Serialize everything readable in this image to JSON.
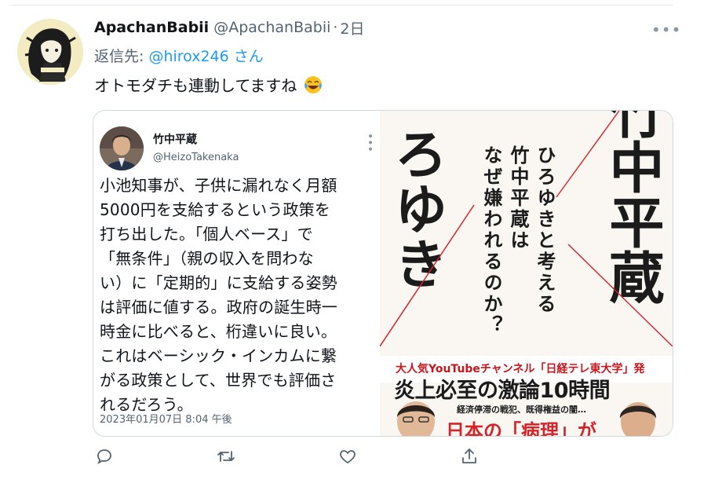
{
  "tweet": {
    "display_name": "ApachanBabii",
    "handle": "@ApachanBabii",
    "separator": "·",
    "time": "2日",
    "reply_prefix": "返信先: ",
    "reply_to": "@hirox246",
    "reply_suffix": " さん",
    "text": "オトモダチも連動してますね",
    "emoji": "laughing-tears-emoji"
  },
  "quoted": {
    "display_name": "竹中平蔵",
    "handle": "@HeizoTakenaka",
    "lines": [
      "小池知事が、子供に漏れなく月額",
      "5000円を支給するという政策を",
      "打ち出した。「個人ベース」で",
      "「無条件」（親の収入を問わな",
      "い）に「定期的」に支給する姿勢",
      "は評価に値する。政府の誕生時一",
      "時金に比べると、桁違いに良い。",
      "これはベーシック・インカムに繋",
      "がる政策として、世界でも評価さ",
      "れるだろう。"
    ],
    "date": "2023年01月07日 8:04 午後"
  },
  "book": {
    "col_right": "竹中平蔵",
    "col_mid1": "ひろゆきと考える",
    "col_mid2": "竹中平蔵は",
    "col_mid3": "なぜ嫌われるのか？",
    "col_left": "ろゆき",
    "band": "大人気YouTubeチャンネル「日経テレ東大学」発",
    "headline": "炎上必至の激論10時間",
    "sub": "経済停滞の戦犯、既得権益の闇…",
    "red": "日本の「病理」が",
    "colors": {
      "accent_red": "#d5232a",
      "band_red": "#c8161d"
    }
  },
  "actions": {
    "reply": "reply-icon",
    "retweet": "retweet-icon",
    "like": "heart-icon",
    "share": "share-icon"
  },
  "colors": {
    "link": "#1d9bf0",
    "muted": "#536471",
    "text": "#0f1419",
    "border": "#cfd9de"
  }
}
